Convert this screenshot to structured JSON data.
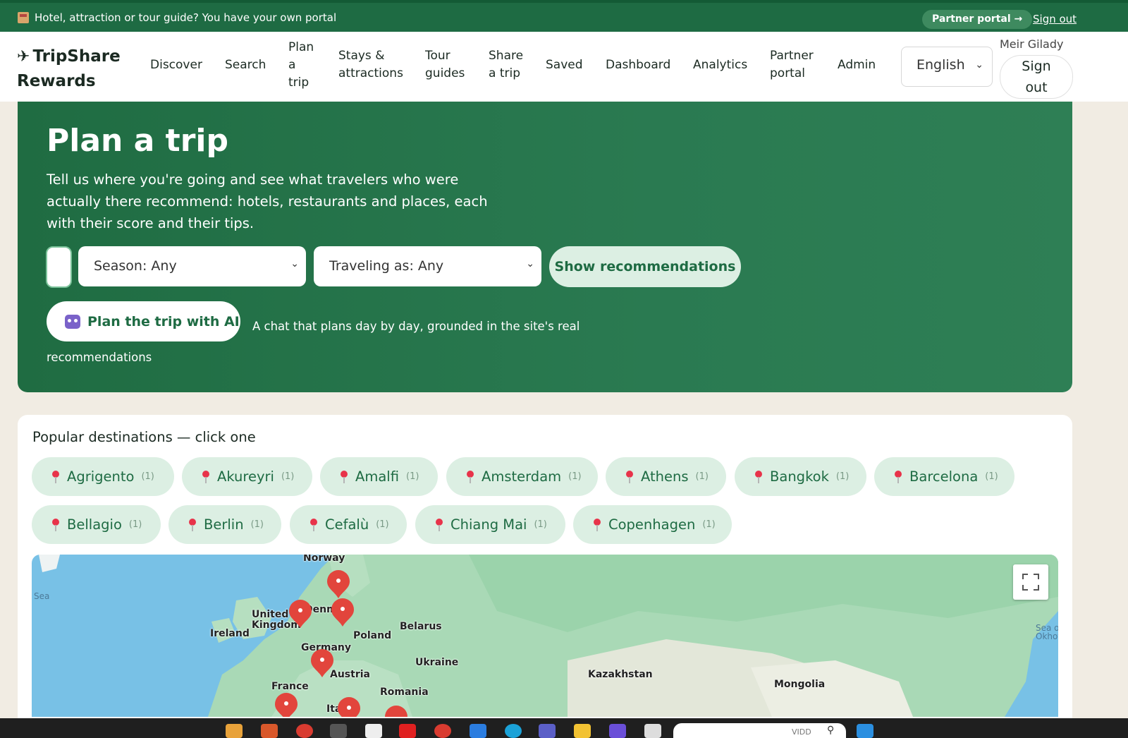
{
  "banner": {
    "message": "Hotel, attraction or tour guide? You have your own portal",
    "partner_portal": "Partner portal →",
    "sign_out": "Sign out"
  },
  "nav": {
    "logo_line1": "TripShare",
    "logo_line2": "Rewards",
    "items": [
      {
        "label": "Discover"
      },
      {
        "label": "Search"
      },
      {
        "label": "Plan\na\ntrip"
      },
      {
        "label": "Stays &\nattractions"
      },
      {
        "label": "Tour\nguides"
      },
      {
        "label": "Share\na trip"
      },
      {
        "label": "Saved"
      },
      {
        "label": "Dashboard"
      },
      {
        "label": "Analytics"
      },
      {
        "label": "Partner\nportal"
      },
      {
        "label": "Admin"
      }
    ],
    "language": "English",
    "user_name": "Meir Gilady",
    "sign_out": "Sign\nout"
  },
  "hero": {
    "title": "Plan a trip",
    "description": "Tell us where you're going and see what travelers who were actually there recommend: hotels, restaurants and places, each with their score and their tips.",
    "season_select": "Season: Any",
    "traveling_select": "Traveling as: Any",
    "show_button": "Show recommendations",
    "ai_button": "Plan the trip with AI",
    "ai_note": "A chat that plans day by day, grounded in the site's real recommendations"
  },
  "destinations": {
    "heading": "Popular destinations — click one",
    "chips": [
      {
        "name": "Agrigento",
        "count": "(1)"
      },
      {
        "name": "Akureyri",
        "count": "(1)"
      },
      {
        "name": "Amalfi",
        "count": "(1)"
      },
      {
        "name": "Amsterdam",
        "count": "(1)"
      },
      {
        "name": "Athens",
        "count": "(1)"
      },
      {
        "name": "Bangkok",
        "count": "(1)"
      },
      {
        "name": "Barcelona",
        "count": "(1)"
      },
      {
        "name": "Bellagio",
        "count": "(1)"
      },
      {
        "name": "Berlin",
        "count": "(1)"
      },
      {
        "name": "Cefalù",
        "count": "(1)"
      },
      {
        "name": "Chiang Mai",
        "count": "(1)"
      },
      {
        "name": "Copenhagen",
        "count": "(1)"
      }
    ]
  },
  "map": {
    "labels": {
      "norway": "Norway",
      "sea_left": "Sea",
      "denmark": "Denma",
      "united_kingdom": "United\nKingdom",
      "ireland": "Ireland",
      "poland": "Poland",
      "belarus": "Belarus",
      "germany": "Germany",
      "ukraine": "Ukraine",
      "austria": "Austria",
      "france": "France",
      "romania": "Romania",
      "italy": "Ita",
      "kazakhstan": "Kazakhstan",
      "mongolia": "Mongolia",
      "sea_right": "Sea o\nOkhot"
    }
  },
  "taskbar": {
    "search_text": "VIDD"
  }
}
